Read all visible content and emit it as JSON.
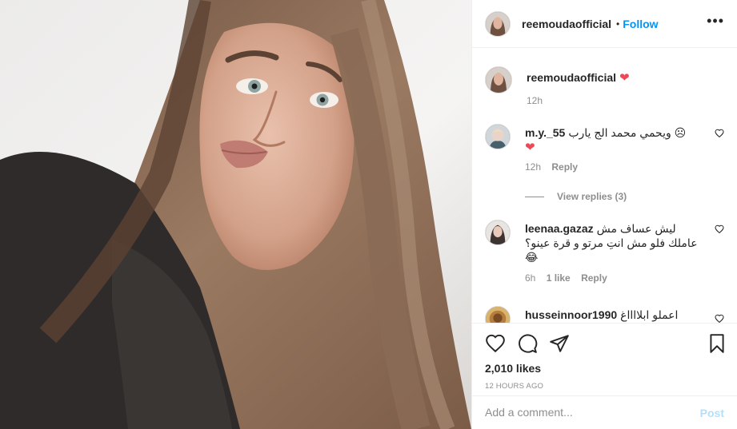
{
  "post": {
    "username": "reemoudaofficial",
    "follow_label": "Follow",
    "separator": "•",
    "more_label": "•••"
  },
  "caption": {
    "username": "reemoudaofficial",
    "emoji": "❤",
    "time": "12h"
  },
  "comments": [
    {
      "username": "m.y._55",
      "text": "ويحمي محمد الج يارب ☹",
      "emoji": "❤",
      "time": "12h",
      "reply_label": "Reply"
    },
    {
      "username": "leenaa.gazaz",
      "text": "ليش عساف مش عاملك فلو مش انتِ مرتو و قرة عينو؟ 😂",
      "time": "6h",
      "likes_label": "1 like",
      "reply_label": "Reply"
    },
    {
      "username": "husseinnoor1990",
      "text": "اعملو ابلااااغ"
    }
  ],
  "view_replies": "View replies (3)",
  "likes": "2,010 likes",
  "timestamp": "12 HOURS AGO",
  "add_comment": {
    "placeholder": "Add a comment...",
    "post_label": "Post"
  },
  "colors": {
    "accent": "#0095f6",
    "heart": "#ed4956",
    "muted": "#8e8e8e",
    "post_disabled": "#b2dffc"
  },
  "icons": [
    "heart-icon",
    "comment-icon",
    "share-icon",
    "bookmark-icon"
  ]
}
